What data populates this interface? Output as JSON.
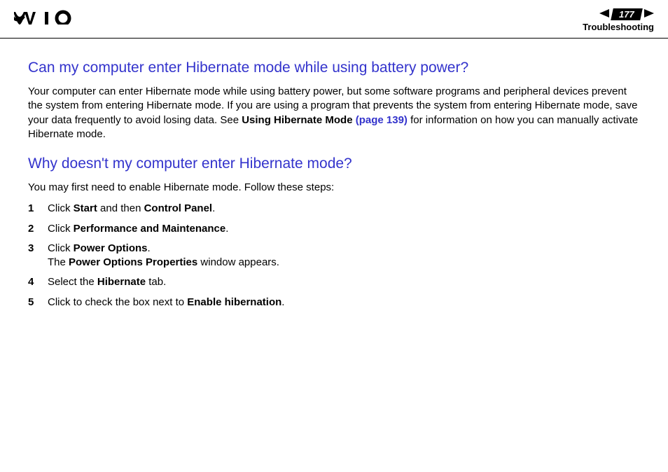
{
  "header": {
    "page_number": "177",
    "section": "Troubleshooting"
  },
  "content": {
    "h1": "Can my computer enter Hibernate mode while using battery power?",
    "p1_a": "Your computer can enter Hibernate mode while using battery power, but some software programs and peripheral devices prevent the system from entering Hibernate mode. If you are using a program that prevents the system from entering Hibernate mode, save your data frequently to avoid losing data. See ",
    "p1_bold": "Using Hibernate Mode ",
    "p1_link": "(page 139)",
    "p1_b": " for information on how you can manually activate Hibernate mode.",
    "h2": "Why doesn't my computer enter Hibernate mode?",
    "p2": "You may first need to enable Hibernate mode. Follow these steps:",
    "steps": [
      {
        "a": "Click ",
        "b1": "Start",
        "mid": " and then ",
        "b2": "Control Panel",
        "end": "."
      },
      {
        "a": "Click ",
        "b1": "Performance and Maintenance",
        "end": "."
      },
      {
        "a": "Click ",
        "b1": "Power Options",
        "end": ".",
        "line2a": "The ",
        "line2b": "Power Options Properties",
        "line2c": " window appears."
      },
      {
        "a": "Select the ",
        "b1": "Hibernate",
        "end": " tab."
      },
      {
        "a": "Click to check the box next to ",
        "b1": "Enable hibernation",
        "end": "."
      }
    ]
  }
}
